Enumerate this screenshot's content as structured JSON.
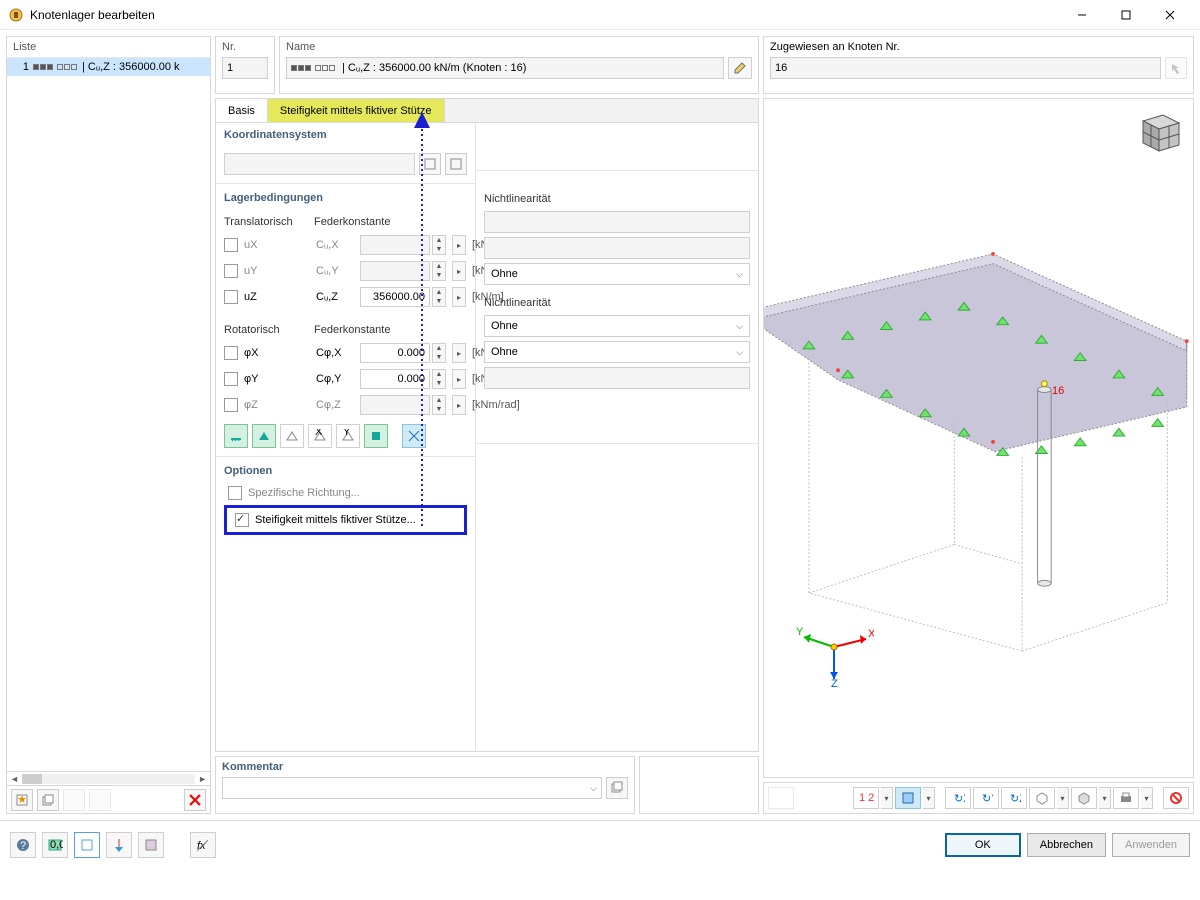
{
  "window": {
    "title": "Knotenlager bearbeiten"
  },
  "list": {
    "header": "Liste",
    "items": [
      {
        "num": "1",
        "text": "| Cᵤ,Z : 356000.00 k"
      }
    ]
  },
  "fields": {
    "nr_label": "Nr.",
    "nr_value": "1",
    "name_label": "Name",
    "name_value": "| Cᵤ,Z : 356000.00 kN/m (Knoten : 16)",
    "assigned_label": "Zugewiesen an Knoten Nr.",
    "assigned_value": "16"
  },
  "tabs": {
    "basis": "Basis",
    "stiff": "Steifigkeit mittels fiktiver Stütze"
  },
  "koord": {
    "title": "Koordinatensystem"
  },
  "support": {
    "title": "Lagerbedingungen",
    "trans_title": "Translatorisch",
    "const_title": "Federkonstante",
    "nonlin_title": "Nichtlinearität",
    "rot_title": "Rotatorisch",
    "rows_t": [
      {
        "dof": "uX",
        "const": "Cᵤ,X",
        "val": "",
        "unit": "[kN/m]",
        "enabled": false
      },
      {
        "dof": "uY",
        "const": "Cᵤ,Y",
        "val": "",
        "unit": "[kN/m]",
        "enabled": false
      },
      {
        "dof": "uZ",
        "const": "Cᵤ,Z",
        "val": "356000.00",
        "unit": "[kN/m]",
        "enabled": true
      }
    ],
    "rows_r": [
      {
        "dof": "φX",
        "const": "Cφ,X",
        "val": "0.000",
        "unit": "[kNm/rad]",
        "enabled": true
      },
      {
        "dof": "φY",
        "const": "Cφ,Y",
        "val": "0.000",
        "unit": "[kNm/rad]",
        "enabled": true
      },
      {
        "dof": "φZ",
        "const": "Cφ,Z",
        "val": "",
        "unit": "[kNm/rad]",
        "enabled": false
      }
    ],
    "nonlin_opts": [
      "",
      "",
      "Ohne",
      "Ohne",
      "Ohne",
      ""
    ],
    "ohne": "Ohne"
  },
  "options": {
    "title": "Optionen",
    "specific": "Spezifische Richtung...",
    "stiffness": "Steifigkeit mittels fiktiver Stütze..."
  },
  "comment": {
    "title": "Kommentar"
  },
  "node_label": "16",
  "axes": {
    "x": "X",
    "y": "Y",
    "z": "Z"
  },
  "buttons": {
    "ok": "OK",
    "cancel": "Abbrechen",
    "apply": "Anwenden"
  }
}
